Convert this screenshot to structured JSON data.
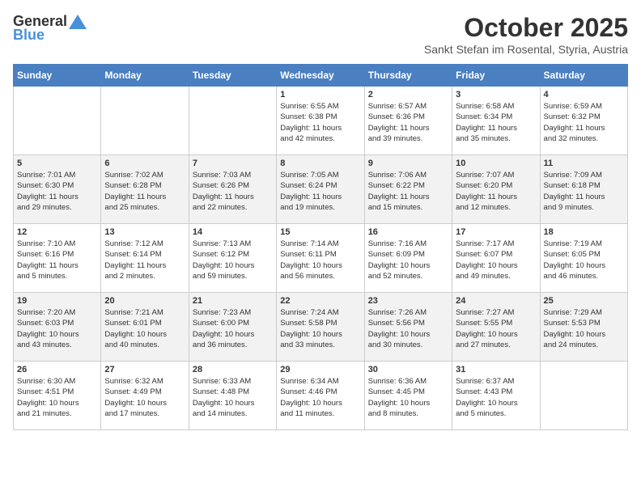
{
  "header": {
    "logo_general": "General",
    "logo_blue": "Blue",
    "month": "October 2025",
    "location": "Sankt Stefan im Rosental, Styria, Austria"
  },
  "weekdays": [
    "Sunday",
    "Monday",
    "Tuesday",
    "Wednesday",
    "Thursday",
    "Friday",
    "Saturday"
  ],
  "weeks": [
    [
      {
        "day": "",
        "info": ""
      },
      {
        "day": "",
        "info": ""
      },
      {
        "day": "",
        "info": ""
      },
      {
        "day": "1",
        "info": "Sunrise: 6:55 AM\nSunset: 6:38 PM\nDaylight: 11 hours\nand 42 minutes."
      },
      {
        "day": "2",
        "info": "Sunrise: 6:57 AM\nSunset: 6:36 PM\nDaylight: 11 hours\nand 39 minutes."
      },
      {
        "day": "3",
        "info": "Sunrise: 6:58 AM\nSunset: 6:34 PM\nDaylight: 11 hours\nand 35 minutes."
      },
      {
        "day": "4",
        "info": "Sunrise: 6:59 AM\nSunset: 6:32 PM\nDaylight: 11 hours\nand 32 minutes."
      }
    ],
    [
      {
        "day": "5",
        "info": "Sunrise: 7:01 AM\nSunset: 6:30 PM\nDaylight: 11 hours\nand 29 minutes."
      },
      {
        "day": "6",
        "info": "Sunrise: 7:02 AM\nSunset: 6:28 PM\nDaylight: 11 hours\nand 25 minutes."
      },
      {
        "day": "7",
        "info": "Sunrise: 7:03 AM\nSunset: 6:26 PM\nDaylight: 11 hours\nand 22 minutes."
      },
      {
        "day": "8",
        "info": "Sunrise: 7:05 AM\nSunset: 6:24 PM\nDaylight: 11 hours\nand 19 minutes."
      },
      {
        "day": "9",
        "info": "Sunrise: 7:06 AM\nSunset: 6:22 PM\nDaylight: 11 hours\nand 15 minutes."
      },
      {
        "day": "10",
        "info": "Sunrise: 7:07 AM\nSunset: 6:20 PM\nDaylight: 11 hours\nand 12 minutes."
      },
      {
        "day": "11",
        "info": "Sunrise: 7:09 AM\nSunset: 6:18 PM\nDaylight: 11 hours\nand 9 minutes."
      }
    ],
    [
      {
        "day": "12",
        "info": "Sunrise: 7:10 AM\nSunset: 6:16 PM\nDaylight: 11 hours\nand 5 minutes."
      },
      {
        "day": "13",
        "info": "Sunrise: 7:12 AM\nSunset: 6:14 PM\nDaylight: 11 hours\nand 2 minutes."
      },
      {
        "day": "14",
        "info": "Sunrise: 7:13 AM\nSunset: 6:12 PM\nDaylight: 10 hours\nand 59 minutes."
      },
      {
        "day": "15",
        "info": "Sunrise: 7:14 AM\nSunset: 6:11 PM\nDaylight: 10 hours\nand 56 minutes."
      },
      {
        "day": "16",
        "info": "Sunrise: 7:16 AM\nSunset: 6:09 PM\nDaylight: 10 hours\nand 52 minutes."
      },
      {
        "day": "17",
        "info": "Sunrise: 7:17 AM\nSunset: 6:07 PM\nDaylight: 10 hours\nand 49 minutes."
      },
      {
        "day": "18",
        "info": "Sunrise: 7:19 AM\nSunset: 6:05 PM\nDaylight: 10 hours\nand 46 minutes."
      }
    ],
    [
      {
        "day": "19",
        "info": "Sunrise: 7:20 AM\nSunset: 6:03 PM\nDaylight: 10 hours\nand 43 minutes."
      },
      {
        "day": "20",
        "info": "Sunrise: 7:21 AM\nSunset: 6:01 PM\nDaylight: 10 hours\nand 40 minutes."
      },
      {
        "day": "21",
        "info": "Sunrise: 7:23 AM\nSunset: 6:00 PM\nDaylight: 10 hours\nand 36 minutes."
      },
      {
        "day": "22",
        "info": "Sunrise: 7:24 AM\nSunset: 5:58 PM\nDaylight: 10 hours\nand 33 minutes."
      },
      {
        "day": "23",
        "info": "Sunrise: 7:26 AM\nSunset: 5:56 PM\nDaylight: 10 hours\nand 30 minutes."
      },
      {
        "day": "24",
        "info": "Sunrise: 7:27 AM\nSunset: 5:55 PM\nDaylight: 10 hours\nand 27 minutes."
      },
      {
        "day": "25",
        "info": "Sunrise: 7:29 AM\nSunset: 5:53 PM\nDaylight: 10 hours\nand 24 minutes."
      }
    ],
    [
      {
        "day": "26",
        "info": "Sunrise: 6:30 AM\nSunset: 4:51 PM\nDaylight: 10 hours\nand 21 minutes."
      },
      {
        "day": "27",
        "info": "Sunrise: 6:32 AM\nSunset: 4:49 PM\nDaylight: 10 hours\nand 17 minutes."
      },
      {
        "day": "28",
        "info": "Sunrise: 6:33 AM\nSunset: 4:48 PM\nDaylight: 10 hours\nand 14 minutes."
      },
      {
        "day": "29",
        "info": "Sunrise: 6:34 AM\nSunset: 4:46 PM\nDaylight: 10 hours\nand 11 minutes."
      },
      {
        "day": "30",
        "info": "Sunrise: 6:36 AM\nSunset: 4:45 PM\nDaylight: 10 hours\nand 8 minutes."
      },
      {
        "day": "31",
        "info": "Sunrise: 6:37 AM\nSunset: 4:43 PM\nDaylight: 10 hours\nand 5 minutes."
      },
      {
        "day": "",
        "info": ""
      }
    ]
  ]
}
